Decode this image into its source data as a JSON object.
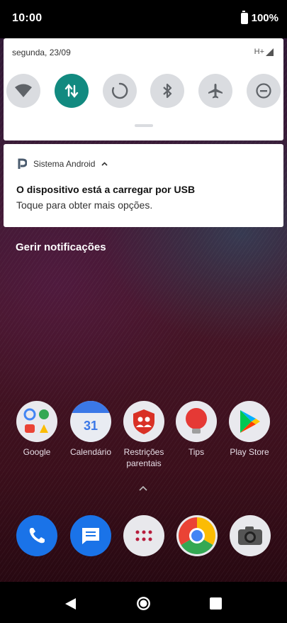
{
  "status": {
    "time": "10:00",
    "battery": "100%"
  },
  "quick_settings": {
    "date": "segunda, 23/09",
    "network": "H+",
    "tiles": [
      {
        "icon": "wifi-icon",
        "on": false
      },
      {
        "icon": "mobile-data-icon",
        "on": true
      },
      {
        "icon": "auto-rotate-icon",
        "on": false
      },
      {
        "icon": "bluetooth-icon",
        "on": false
      },
      {
        "icon": "airplane-icon",
        "on": false
      },
      {
        "icon": "do-not-disturb-icon",
        "on": false
      }
    ]
  },
  "notification": {
    "app": "Sistema Android",
    "title": "O dispositivo está a carregar por USB",
    "body": "Toque para obter mais opções."
  },
  "manage_label": "Gerir notificações",
  "home_apps": [
    {
      "label": "Google",
      "icon": "google-folder-icon"
    },
    {
      "label": "Calendário",
      "icon": "calendar-icon",
      "text": "31"
    },
    {
      "label": "Restrições parentais",
      "icon": "parental-controls-icon"
    },
    {
      "label": "Tips",
      "icon": "tips-icon"
    },
    {
      "label": "Play Store",
      "icon": "play-store-icon"
    }
  ],
  "dock": [
    {
      "icon": "phone-icon"
    },
    {
      "icon": "messages-icon"
    },
    {
      "icon": "app-drawer-icon"
    },
    {
      "icon": "chrome-icon"
    },
    {
      "icon": "camera-icon"
    }
  ],
  "colors": {
    "accent_tile": "#128a80",
    "tile_off": "#dadce0"
  }
}
